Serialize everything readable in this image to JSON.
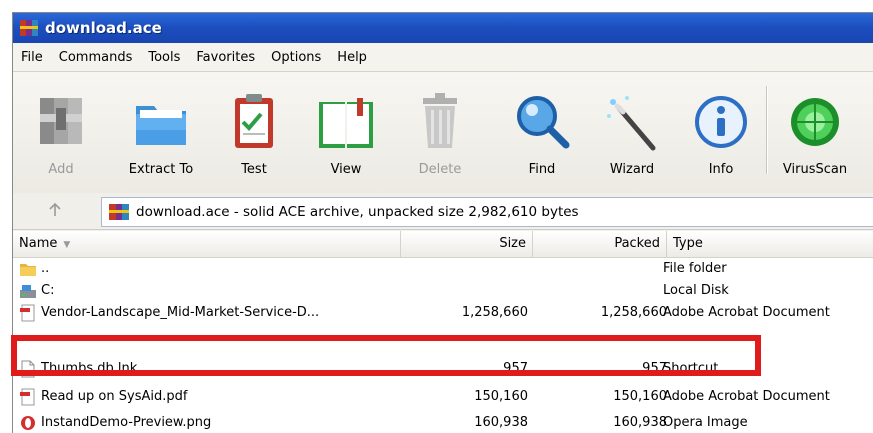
{
  "window": {
    "title": "download.ace"
  },
  "menu": [
    "File",
    "Commands",
    "Tools",
    "Favorites",
    "Options",
    "Help"
  ],
  "toolbar": [
    {
      "label": "Add",
      "icon": "add-archive-icon",
      "enabled": false
    },
    {
      "label": "Extract To",
      "icon": "extract-folder-icon",
      "enabled": true
    },
    {
      "label": "Test",
      "icon": "test-clipboard-icon",
      "enabled": true
    },
    {
      "label": "View",
      "icon": "view-book-icon",
      "enabled": true
    },
    {
      "label": "Delete",
      "icon": "delete-trash-icon",
      "enabled": false
    },
    {
      "label": "Find",
      "icon": "find-magnifier-icon",
      "enabled": true
    },
    {
      "label": "Wizard",
      "icon": "wizard-wand-icon",
      "enabled": true
    },
    {
      "label": "Info",
      "icon": "info-icon",
      "enabled": true
    },
    {
      "label": "VirusScan",
      "icon": "virus-scan-icon",
      "enabled": true
    }
  ],
  "address": {
    "up_icon": "up-arrow-icon",
    "path_text": "download.ace - solid ACE archive, unpacked size 2,982,610 bytes"
  },
  "columns": {
    "name": "Name",
    "size": "Size",
    "packed": "Packed",
    "type": "Type"
  },
  "files": [
    {
      "name": "..",
      "size": "",
      "packed": "",
      "type": "File folder",
      "icon": "folder-icon"
    },
    {
      "name": "C:",
      "size": "",
      "packed": "",
      "type": "Local Disk",
      "icon": "local-disk-icon"
    },
    {
      "name": "Vendor-Landscape_Mid-Market-Service-D...",
      "size": "1,258,660",
      "packed": "1,258,660",
      "type": "Adobe Acrobat Document",
      "icon": "pdf-file-icon"
    },
    {
      "name": "Thumbs.db.lnk",
      "size": "957",
      "packed": "957",
      "type": "Shortcut",
      "icon": "blank-file-icon"
    },
    {
      "name": "Read up on SysAid.pdf",
      "size": "150,160",
      "packed": "150,160",
      "type": "Adobe Acrobat Document",
      "icon": "pdf-file-icon"
    },
    {
      "name": "InstandDemo-Preview.png",
      "size": "160,938",
      "packed": "160,938",
      "type": "Opera Image",
      "icon": "opera-image-icon"
    }
  ],
  "colors": {
    "title_bar": "#1d4fc0",
    "highlight": "#e01b1b"
  }
}
